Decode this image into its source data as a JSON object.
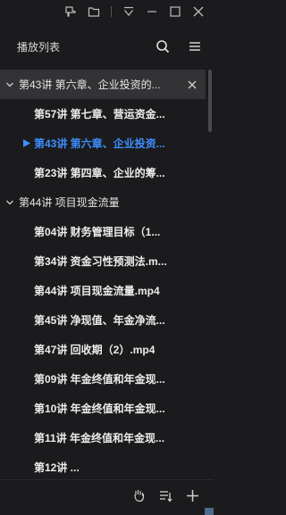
{
  "header": {
    "title": "播放列表"
  },
  "groups": [
    {
      "label": "第43讲 第六章、企业投资的...",
      "expanded": true,
      "items": [
        {
          "label": "第57讲 第七章、营运资金..."
        },
        {
          "label": "第43讲 第六章、企业投资...",
          "playing": true
        },
        {
          "label": "第23讲 第四章、企业的筹..."
        }
      ]
    },
    {
      "label": "第44讲 项目现金流量",
      "expanded": true,
      "items": [
        {
          "label": "第04讲 财务管理目标（1..."
        },
        {
          "label": "第34讲 资金习性预测法.m..."
        },
        {
          "label": "第44讲 项目现金流量.mp4"
        },
        {
          "label": "第45讲 净现值、年金净流..."
        },
        {
          "label": "第47讲 回收期（2）.mp4"
        },
        {
          "label": "第09讲 年金终值和年金现..."
        },
        {
          "label": "第10讲 年金终值和年金现..."
        },
        {
          "label": "第11讲 年金终值和年金现..."
        },
        {
          "label": "第12讲 ..."
        }
      ]
    }
  ],
  "colors": {
    "background": "#1b1b1d",
    "active_group": "#333336",
    "playing": "#3d8eff"
  }
}
